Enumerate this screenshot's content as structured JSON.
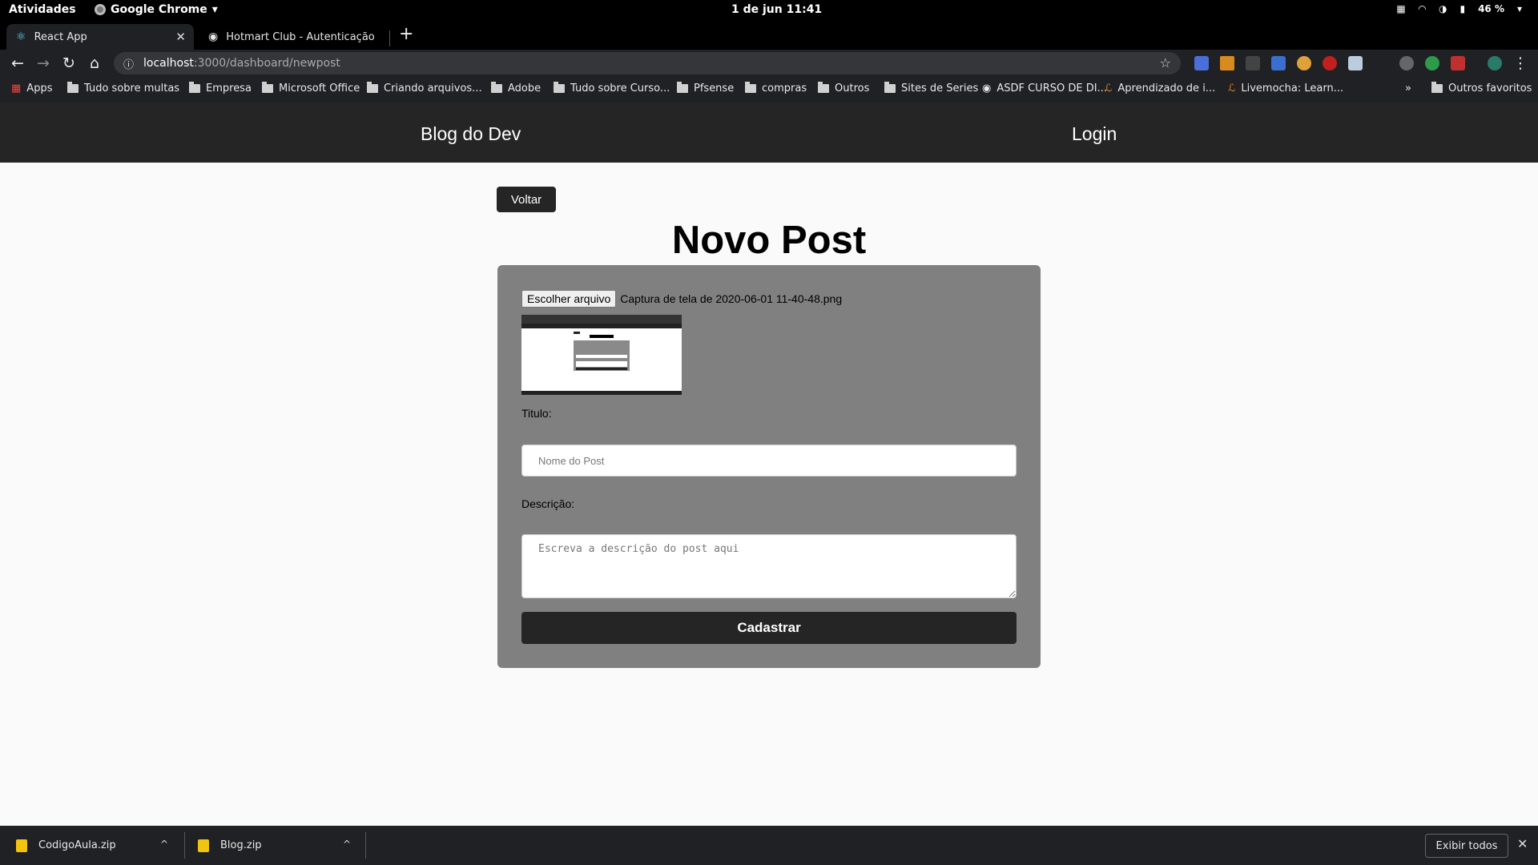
{
  "system": {
    "activities": "Atividades",
    "app_name": "Google Chrome",
    "clock": "1 de jun  11:41",
    "battery": "46 %"
  },
  "tabs": [
    {
      "title": "React App",
      "close": "✕"
    },
    {
      "title": "Hotmart Club - Autenticação"
    }
  ],
  "toolbar": {
    "url_host": "localhost",
    "url_path": ":3000/dashboard/newpost",
    "new_tab": "+"
  },
  "bookmarks": [
    "Apps",
    "Tudo sobre multas",
    "Empresa",
    "Microsoft Office",
    "Criando arquivos...",
    "Adobe",
    "Tudo sobre Curso...",
    "Pfsense",
    "compras",
    "Outros",
    "Sites de Series",
    "ASDF CURSO DE DI...",
    "Aprendizado de i...",
    "Livemocha: Learn..."
  ],
  "bookmarks_overflow": "»",
  "bookmarks_other": "Outros favoritos",
  "header": {
    "brand": "Blog do Dev",
    "login": "Login"
  },
  "page": {
    "back_label": "Voltar",
    "title": "Novo Post"
  },
  "form": {
    "file_button": "Escolher arquivo",
    "file_name": "Captura de tela de 2020-06-01 11-40-48.png",
    "preview_title": "Novo Post",
    "title_label": "Titulo:",
    "title_placeholder": "Nome do Post",
    "desc_label": "Descrição:",
    "desc_placeholder": "Escreva a descrição do post aqui",
    "submit_label": "Cadastrar"
  },
  "downloads": {
    "items": [
      "CodigoAula.zip",
      "Blog.zip"
    ],
    "show_all": "Exibir todos"
  },
  "colors": {
    "header_bg": "#252525",
    "card_bg": "#808080",
    "page_bg": "#fafafa",
    "browser_dark": "#202124"
  }
}
